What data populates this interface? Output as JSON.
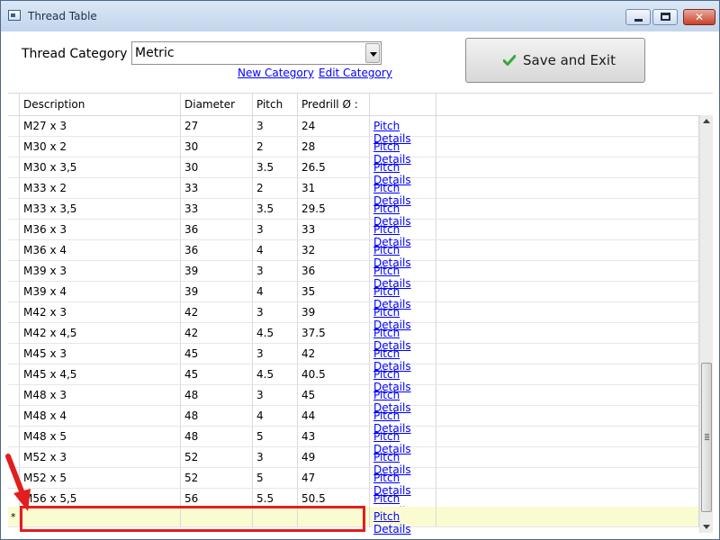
{
  "window": {
    "title": "Thread Table",
    "close_glyph": "✕"
  },
  "form": {
    "category_label": "Thread Category :",
    "category_value": "Metric",
    "new_category_link": "New Category",
    "edit_category_link": "Edit Category",
    "save_button_label": "Save and Exit",
    "save_icon": "green-checkmark-icon"
  },
  "grid": {
    "columns": [
      "Description",
      "Diameter",
      "Pitch",
      "Predrill Ø :",
      ""
    ],
    "rows": [
      {
        "description": "M27 x 3",
        "diameter": "27",
        "pitch": "3",
        "predrill": "24",
        "link": "Pitch Details"
      },
      {
        "description": "M30 x 2",
        "diameter": "30",
        "pitch": "2",
        "predrill": "28",
        "link": "Pitch Details"
      },
      {
        "description": "M30 x 3,5",
        "diameter": "30",
        "pitch": "3.5",
        "predrill": "26.5",
        "link": "Pitch Details"
      },
      {
        "description": "M33 x 2",
        "diameter": "33",
        "pitch": "2",
        "predrill": "31",
        "link": "Pitch Details"
      },
      {
        "description": "M33 x 3,5",
        "diameter": "33",
        "pitch": "3.5",
        "predrill": "29.5",
        "link": "Pitch Details"
      },
      {
        "description": "M36 x 3",
        "diameter": "36",
        "pitch": "3",
        "predrill": "33",
        "link": "Pitch Details"
      },
      {
        "description": "M36 x 4",
        "diameter": "36",
        "pitch": "4",
        "predrill": "32",
        "link": "Pitch Details"
      },
      {
        "description": "M39 x 3",
        "diameter": "39",
        "pitch": "3",
        "predrill": "36",
        "link": "Pitch Details"
      },
      {
        "description": "M39 x 4",
        "diameter": "39",
        "pitch": "4",
        "predrill": "35",
        "link": "Pitch Details"
      },
      {
        "description": "M42 x 3",
        "diameter": "42",
        "pitch": "3",
        "predrill": "39",
        "link": "Pitch Details"
      },
      {
        "description": "M42 x 4,5",
        "diameter": "42",
        "pitch": "4.5",
        "predrill": "37.5",
        "link": "Pitch Details"
      },
      {
        "description": "M45 x 3",
        "diameter": "45",
        "pitch": "3",
        "predrill": "42",
        "link": "Pitch Details"
      },
      {
        "description": "M45 x 4,5",
        "diameter": "45",
        "pitch": "4.5",
        "predrill": "40.5",
        "link": "Pitch Details"
      },
      {
        "description": "M48 x 3",
        "diameter": "48",
        "pitch": "3",
        "predrill": "45",
        "link": "Pitch Details"
      },
      {
        "description": "M48 x 4",
        "diameter": "48",
        "pitch": "4",
        "predrill": "44",
        "link": "Pitch Details"
      },
      {
        "description": "M48 x 5",
        "diameter": "48",
        "pitch": "5",
        "predrill": "43",
        "link": "Pitch Details"
      },
      {
        "description": "M52 x 3",
        "diameter": "52",
        "pitch": "3",
        "predrill": "49",
        "link": "Pitch Details"
      },
      {
        "description": "M52 x 5",
        "diameter": "52",
        "pitch": "5",
        "predrill": "47",
        "link": "Pitch Details"
      },
      {
        "description": "M56 x 5,5",
        "diameter": "56",
        "pitch": "5.5",
        "predrill": "50.5",
        "link": "Pitch Details"
      }
    ],
    "new_row": {
      "marker": "*",
      "description": "",
      "diameter": "",
      "pitch": "",
      "predrill": "",
      "link": "Pitch Details"
    }
  },
  "annotation": {
    "highlight_color": "#e21e1e",
    "arrow_icon": "red-arrow-icon"
  }
}
